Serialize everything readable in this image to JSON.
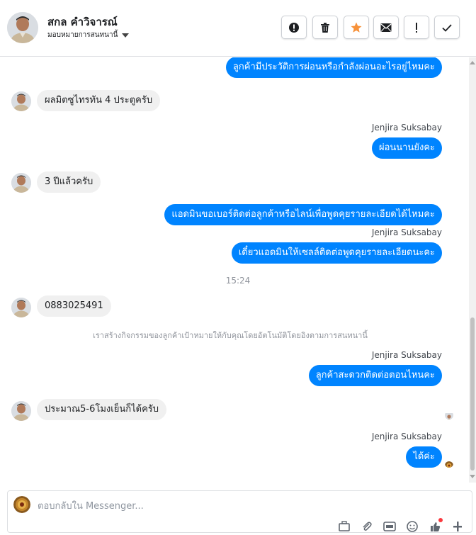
{
  "header": {
    "contact_name": "สกล คำวิจารณ์",
    "assign_label": "มอบหมายการสนทนานี้",
    "tools": [
      {
        "icon": "alert-circle-icon",
        "name": "mark-spam-button"
      },
      {
        "icon": "trash-icon",
        "name": "delete-button"
      },
      {
        "icon": "star-icon",
        "name": "star-button"
      },
      {
        "icon": "mail-icon",
        "name": "mark-unread-button"
      },
      {
        "icon": "exclamation-icon",
        "name": "follow-up-button"
      },
      {
        "icon": "check-icon",
        "name": "mark-done-button"
      }
    ],
    "star_color": "#f7923a"
  },
  "messages": {
    "m1": "ลูกค้ามีประวัติการผ่อนหรือกำลังผ่อนอะไรอยู่ไหมคะ",
    "m2": "ผลมิตซูไทรทัน 4 ประตูครับ",
    "m3_sender": "Jenjira Suksabay",
    "m3": "ผ่อนนานยังคะ",
    "m4": "3 ปีแล้วครับ",
    "m5": "แอดมินขอเบอร์ติดต่อลูกค้าหรือไลน์เพื่อพูดคุยรายละเอียดได้ไหมคะ",
    "m6_sender": "Jenjira Suksabay",
    "m6": "เดี๋ยวแอดมินให้เซลล์ติดต่อพูดคุยรายละเอียดนะคะ",
    "time": "15:24",
    "m7": "0883025491",
    "system_note": "เราสร้างกิจกรรมของลูกค้าเป้าหมายให้กับคุณโดยอัตโนมัติโดยอิงตามการสนทนานี้",
    "m8_sender": "Jenjira Suksabay",
    "m8": "ลูกค้าสะดวกติดต่อตอนไหนคะ",
    "m9": "ประมาณ5-6โมงเย็นก็ได้ครับ",
    "m10_sender": "Jenjira Suksabay",
    "m10": "ได้ค่ะ"
  },
  "composer": {
    "placeholder": "ตอบกลับใน Messenger..."
  },
  "colors": {
    "outgoing_bubble": "#0084ff",
    "incoming_bubble": "#f0f0f0",
    "notification_dot": "#fa383e"
  }
}
